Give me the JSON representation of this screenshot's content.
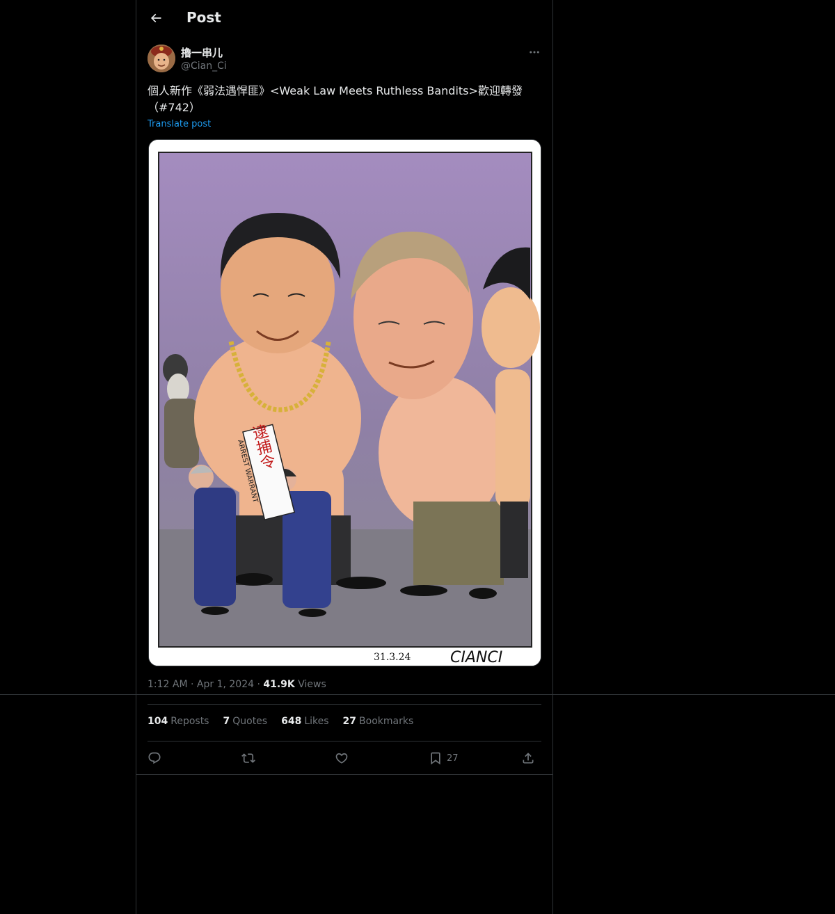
{
  "header": {
    "back_icon": "arrow-left-icon",
    "title": "Post"
  },
  "author": {
    "display_name": "擼一串儿",
    "handle": "@Cian_Ci",
    "avatar": "avatar-portrait"
  },
  "post": {
    "text": "個人新作《弱法遇悍匪》<Weak Law Meets Ruthless Bandits>歡迎轉發（#742）",
    "translate_label": "Translate post",
    "media": {
      "sign_text": "逮捕令",
      "banner_text": "ARREST WARRANT",
      "date_text": "31.3.24",
      "signature": "CIANCI"
    },
    "time": "1:12 AM",
    "date": "Apr 1, 2024",
    "views_count": "41.9K",
    "views_label": "Views"
  },
  "stats": [
    {
      "count": "104",
      "label": "Reposts"
    },
    {
      "count": "7",
      "label": "Quotes"
    },
    {
      "count": "648",
      "label": "Likes"
    },
    {
      "count": "27",
      "label": "Bookmarks"
    }
  ],
  "actions": {
    "bookmark_count": "27"
  },
  "colors": {
    "background": "#000000",
    "text": "#e7e9ea",
    "secondary": "#71767b",
    "link": "#1d9bf0",
    "border": "#2f3336"
  }
}
